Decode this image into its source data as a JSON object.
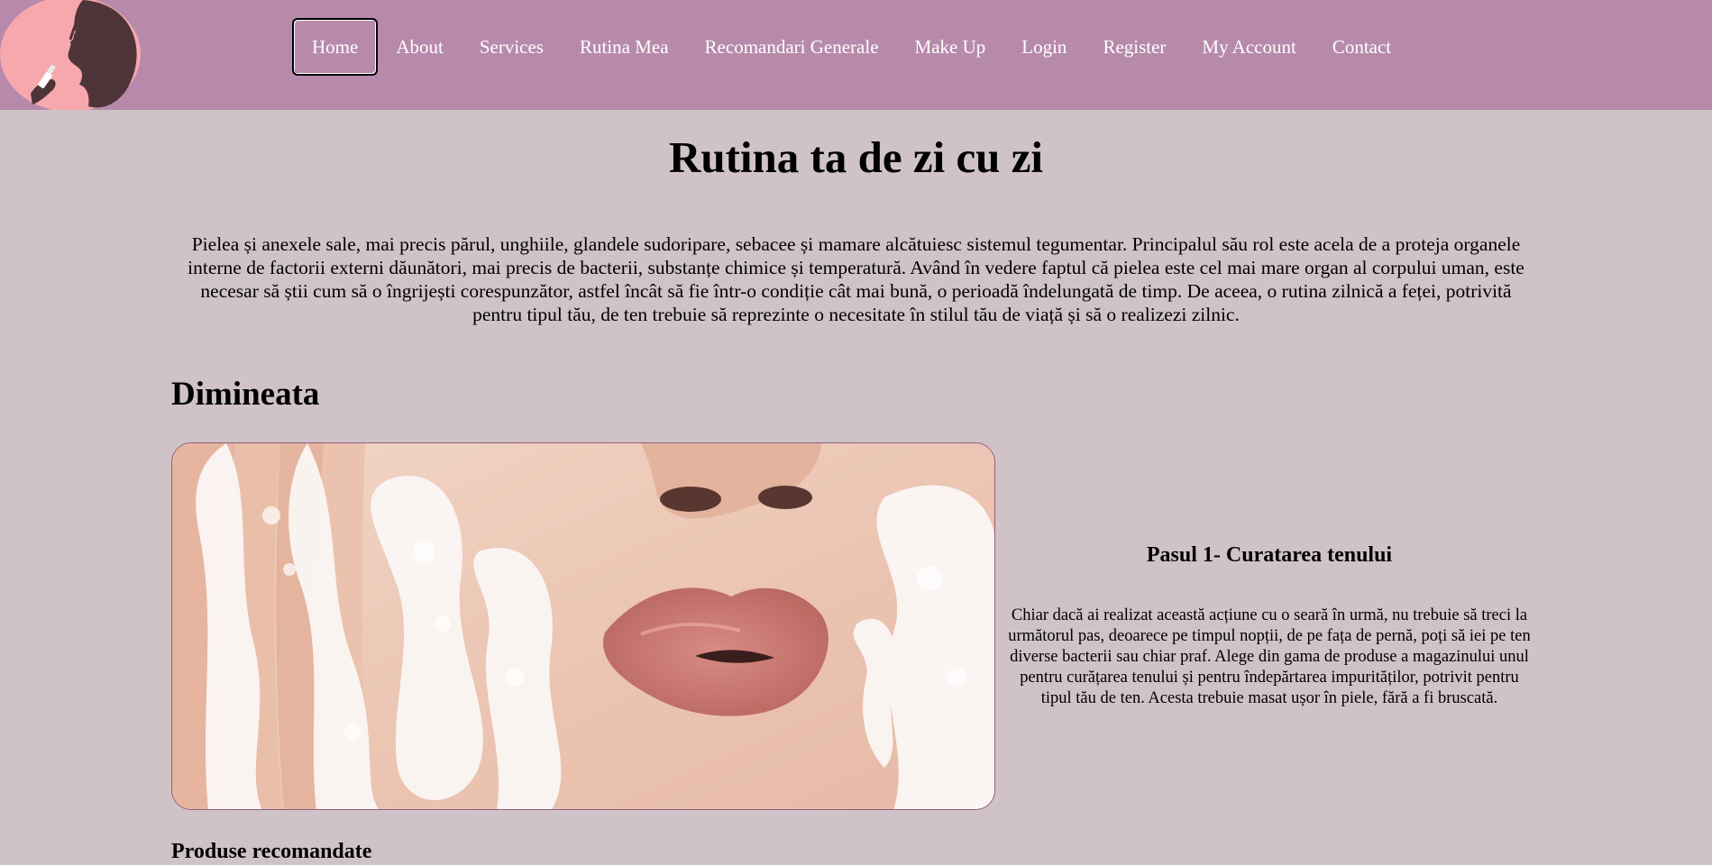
{
  "nav": {
    "items": [
      {
        "label": "Home",
        "active": true
      },
      {
        "label": "About"
      },
      {
        "label": "Services"
      },
      {
        "label": "Rutina Mea"
      },
      {
        "label": "Recomandari Generale"
      },
      {
        "label": "Make Up"
      },
      {
        "label": "Login"
      },
      {
        "label": "Register"
      },
      {
        "label": "My Account"
      },
      {
        "label": "Contact"
      }
    ]
  },
  "colors": {
    "header_bg": "#b78aab",
    "page_bg": "#d0c3c7",
    "nav_text": "#ffffff"
  },
  "logo": {
    "icon": "woman-silhouette-lipstick-logo"
  },
  "main": {
    "title": "Rutina ta de zi cu zi",
    "intro": "Pielea și anexele sale, mai precis părul, unghiile, glandele sudoripare, sebacee și mamare alcătuiesc sistemul tegumentar. Principalul său rol este acela de a proteja organele interne de factorii externi dăunători, mai precis de bacterii, substanțe chimice și temperatură. Având în vedere faptul că pielea este cel mai mare organ al corpului uman, este necesar să știi cum să o îngrijești corespunzător, astfel încât să fie într-o condiție cât mai bună, o perioadă îndelungată de timp. De aceea, o rutina zilnică a feței, potrivită pentru tipul tău, de ten trebuie să reprezinte o necesitate în stilul tău de viață și să o realizezi zilnic.",
    "section_heading": "Dimineata",
    "step": {
      "title": "Pasul 1- Curatarea tenului",
      "body": "Chiar dacă ai realizat această acțiune cu o seară în urmă, nu trebuie să treci la următorul pas, deoarece pe timpul nopții, de pe fața de pernă, poți să iei pe ten diverse bacterii sau chiar praf. Alege din gama de produse a magazinului unul pentru curățarea tenului și pentru îndepărtarea impurităților, potrivit pentru tipul tău de ten. Acesta trebuie masat ușor în piele, fără a fi bruscată."
    },
    "products_heading": "Produse recomandate"
  }
}
